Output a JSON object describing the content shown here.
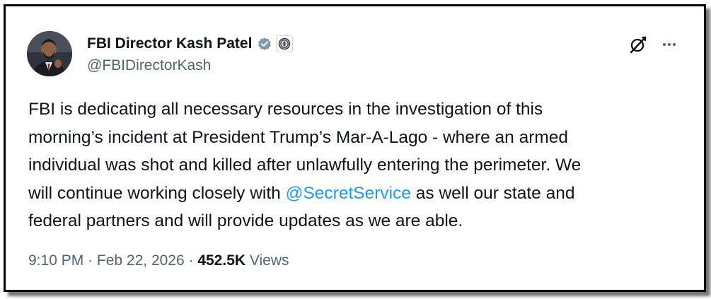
{
  "author": {
    "display_name": "FBI Director Kash Patel",
    "handle": "@FBIDirectorKash",
    "verified_icon": "verified-badge-icon",
    "affiliation_icon": "fbi-seal-icon",
    "avatar_icon": "profile-photo"
  },
  "actions": {
    "grok_icon": "grok-icon",
    "more_icon": "more-options-icon"
  },
  "tweet": {
    "line1": "FBI is dedicating all necessary resources in the investigation of this",
    "line2": "morning’s incident at President Trump’s Mar-A-Lago - where an armed",
    "line3": "individual was shot and killed after unlawfully entering the perimeter. We",
    "line4_before": "will continue working closely with ",
    "line4_mention": "@SecretService",
    "line4_after": " as well our state and",
    "line5": "federal partners and will provide updates as we are able."
  },
  "meta": {
    "time": "9:10 PM",
    "separator1": " · ",
    "date": "Feb 22, 2026",
    "separator2": " · ",
    "views_count": "452.5K",
    "views_label": " Views"
  },
  "colors": {
    "text": "#0f1419",
    "secondary": "#536471",
    "link": "#1d9bf0",
    "verified": "#829aab"
  }
}
